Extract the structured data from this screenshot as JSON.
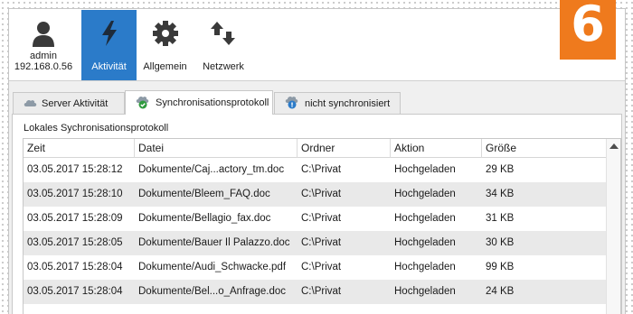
{
  "toolbar": {
    "admin": {
      "name": "admin",
      "ip": "192.168.0.56",
      "icon": "user-icon"
    },
    "items": [
      {
        "label": "Aktivität",
        "icon": "lightning-icon",
        "active": true
      },
      {
        "label": "Allgemein",
        "icon": "gear-icon",
        "active": false
      },
      {
        "label": "Netzwerk",
        "icon": "network-arrows-icon",
        "active": false
      }
    ]
  },
  "badge": {
    "text": "6",
    "color": "#ef7a1d"
  },
  "tabs": [
    {
      "label": "Server Aktivität",
      "icon": "cloud-icon",
      "active": false
    },
    {
      "label": "Synchronisationsprotokoll",
      "icon": "cloud-check-icon",
      "active": true
    },
    {
      "label": "nicht synchronisiert",
      "icon": "cloud-warning-icon",
      "active": false
    }
  ],
  "section_title": "Lokales Sychronisationsprotokoll",
  "table": {
    "columns": [
      "Zeit",
      "Datei",
      "Ordner",
      "Aktion",
      "Größe"
    ],
    "rows": [
      [
        "03.05.2017 15:28:12",
        "Dokumente/Caj...actory_tm.doc",
        "C:\\Privat",
        "Hochgeladen",
        "29 KB"
      ],
      [
        "03.05.2017 15:28:10",
        "Dokumente/Bleem_FAQ.doc",
        "C:\\Privat",
        "Hochgeladen",
        "34 KB"
      ],
      [
        "03.05.2017 15:28:09",
        "Dokumente/Bellagio_fax.doc",
        "C:\\Privat",
        "Hochgeladen",
        "31 KB"
      ],
      [
        "03.05.2017 15:28:05",
        "Dokumente/Bauer Il Palazzo.doc",
        "C:\\Privat",
        "Hochgeladen",
        "30 KB"
      ],
      [
        "03.05.2017 15:28:04",
        "Dokumente/Audi_Schwacke.pdf",
        "C:\\Privat",
        "Hochgeladen",
        "99 KB"
      ],
      [
        "03.05.2017 15:28:04",
        "Dokumente/Bel...o_Anfrage.doc",
        "C:\\Privat",
        "Hochgeladen",
        "24 KB"
      ]
    ]
  },
  "colors": {
    "accent": "#2b7bc9",
    "badge": "#ef7a1d",
    "row_alt": "#e9e9e9"
  }
}
